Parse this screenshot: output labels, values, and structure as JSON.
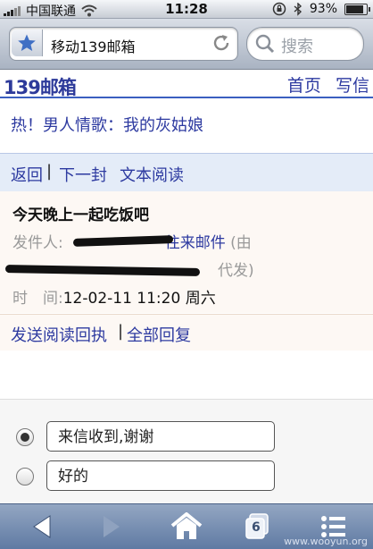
{
  "status_bar": {
    "carrier": "中国联通",
    "time": "11:28",
    "battery": "93%",
    "battery_level": 0.93
  },
  "browser": {
    "url_title": "移动139邮箱",
    "search_placeholder": "搜索"
  },
  "page": {
    "logo": "139邮箱",
    "top_links": [
      "首页",
      "写信"
    ],
    "hot_link": "热！男人情歌：我的灰姑娘",
    "actions": [
      "返回",
      "下一封",
      "文本阅读"
    ],
    "mail": {
      "subject": "今天晚上一起吃饭吧",
      "from_label": "发件人:",
      "folder": "往来邮件",
      "from_tail": "(由",
      "proxy_suffix": "代发)",
      "time_label": "时　间:",
      "time_value": "12-02-11 11:20 周六"
    },
    "reply_links": [
      "发送阅读回执",
      "全部回复"
    ],
    "quick_replies": [
      {
        "text": "来信收到,谢谢",
        "checked": true
      },
      {
        "text": "好的",
        "checked": false
      }
    ]
  },
  "toolbar": {
    "tab_count": "6",
    "watermark": "www.wooyun.org"
  }
}
